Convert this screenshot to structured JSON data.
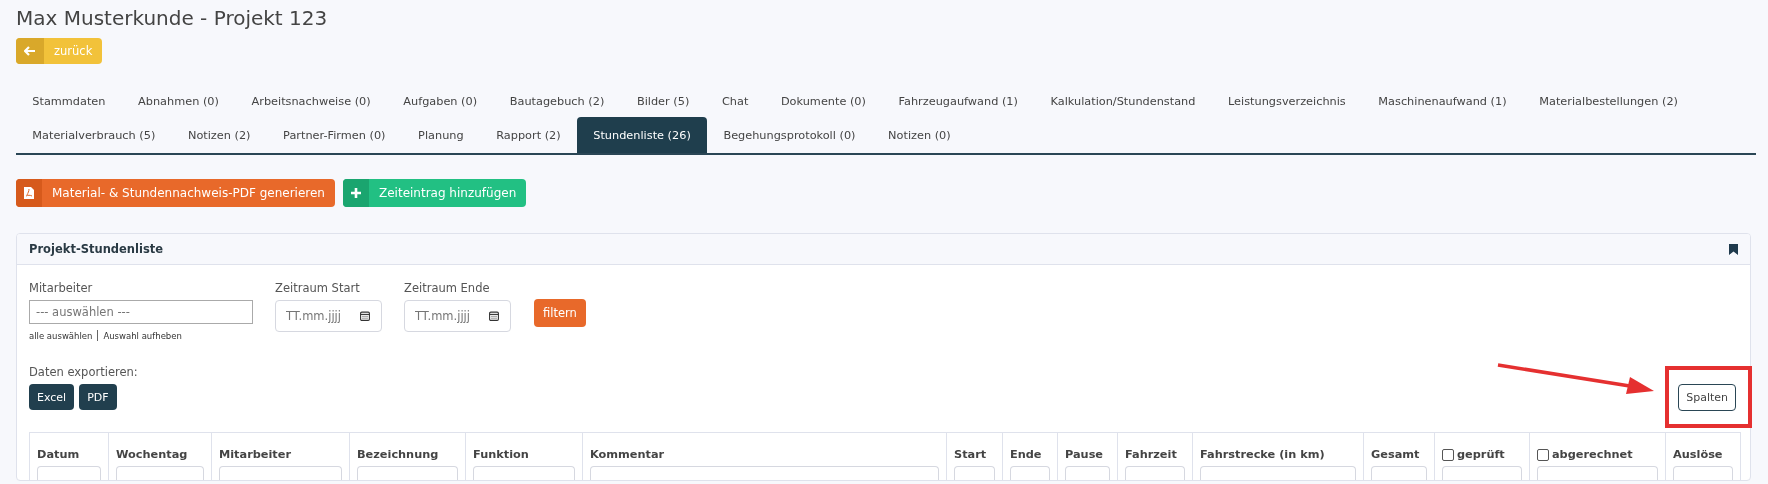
{
  "page_title": "Max Musterkunde - Projekt 123",
  "back_button": {
    "label": "zurück"
  },
  "tab_rows": [
    [
      {
        "label": "Stammdaten",
        "selected": false
      },
      {
        "label": "Abnahmen (0)",
        "selected": false
      },
      {
        "label": "Arbeitsnachweise (0)",
        "selected": false
      },
      {
        "label": "Aufgaben (0)",
        "selected": false
      },
      {
        "label": "Bautagebuch (2)",
        "selected": false
      },
      {
        "label": "Bilder (5)",
        "selected": false
      },
      {
        "label": "Chat",
        "selected": false
      },
      {
        "label": "Dokumente (0)",
        "selected": false
      },
      {
        "label": "Fahrzeugaufwand (1)",
        "selected": false
      },
      {
        "label": "Kalkulation/Stundenstand",
        "selected": false
      },
      {
        "label": "Leistungsverzeichnis",
        "selected": false
      },
      {
        "label": "Maschinenaufwand (1)",
        "selected": false
      },
      {
        "label": "Materialbestellungen (2)",
        "selected": false
      }
    ],
    [
      {
        "label": "Materialverbrauch (5)",
        "selected": false
      },
      {
        "label": "Notizen (2)",
        "selected": false
      },
      {
        "label": "Partner-Firmen (0)",
        "selected": false
      },
      {
        "label": "Planung",
        "selected": false
      },
      {
        "label": "Rapport (2)",
        "selected": false
      },
      {
        "label": "Stundenliste (26)",
        "selected": true
      },
      {
        "label": "Begehungsprotokoll (0)",
        "selected": false
      },
      {
        "label": "Notizen (0)",
        "selected": false
      }
    ]
  ],
  "actions": [
    {
      "kind": "pdf",
      "label": "Material- & Stundennachweis-PDF generieren"
    },
    {
      "kind": "add",
      "label": "Zeiteintrag hinzufügen"
    }
  ],
  "card": {
    "title": "Projekt-Stundenliste",
    "filters": {
      "employee": {
        "label": "Mitarbeiter",
        "placeholder": "--- auswählen ---",
        "links": [
          "alle auswählen",
          "Auswahl aufheben"
        ]
      },
      "dates": [
        {
          "label": "Zeitraum Start",
          "placeholder": "TT.mm.jjjj"
        },
        {
          "label": "Zeitraum Ende",
          "placeholder": "TT.mm.jjjj"
        }
      ],
      "filter_button": "filtern"
    },
    "export": {
      "label": "Daten exportieren:",
      "buttons": [
        "Excel",
        "PDF"
      ]
    },
    "columns_button": "Spalten",
    "table": {
      "columns": [
        {
          "label": "Datum",
          "kind": "text"
        },
        {
          "label": "Wochentag",
          "kind": "text"
        },
        {
          "label": "Mitarbeiter",
          "kind": "text"
        },
        {
          "label": "Bezeichnung",
          "kind": "text"
        },
        {
          "label": "Funktion",
          "kind": "text"
        },
        {
          "label": "Kommentar",
          "kind": "text"
        },
        {
          "label": "Start",
          "kind": "text"
        },
        {
          "label": "Ende",
          "kind": "text"
        },
        {
          "label": "Pause",
          "kind": "text"
        },
        {
          "label": "Fahrzeit",
          "kind": "text"
        },
        {
          "label": "Fahrstrecke (in km)",
          "kind": "text"
        },
        {
          "label": "Gesamt",
          "kind": "text"
        },
        {
          "label": "geprüft",
          "kind": "checkbox",
          "checked": false
        },
        {
          "label": "abgerechnet",
          "kind": "checkbox",
          "checked": false
        },
        {
          "label": "Auslöse",
          "kind": "text"
        }
      ]
    }
  }
}
